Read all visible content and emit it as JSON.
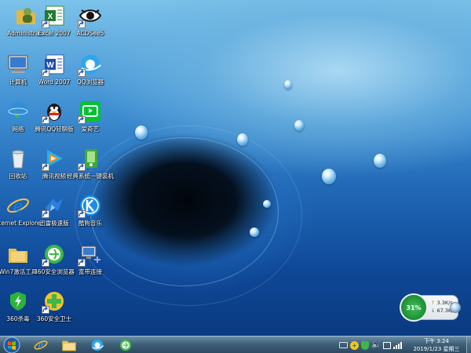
{
  "desktop_icons": [
    {
      "id": "admin-folder",
      "label": "Administra...",
      "icon": "user-folder-icon",
      "shortcut": false
    },
    {
      "id": "excel",
      "label": "Excel 2007",
      "icon": "excel-icon",
      "shortcut": true
    },
    {
      "id": "acdsee",
      "label": "ACDSee5",
      "icon": "eye-icon",
      "shortcut": true
    },
    {
      "id": "computer",
      "label": "计算机",
      "icon": "computer-icon",
      "shortcut": false
    },
    {
      "id": "word",
      "label": "Word 2007",
      "icon": "word-icon",
      "shortcut": true
    },
    {
      "id": "qq-browser",
      "label": "QQ浏览器",
      "icon": "qq-browser-icon",
      "shortcut": true
    },
    {
      "id": "network",
      "label": "网络",
      "icon": "network-globe-icon",
      "shortcut": false
    },
    {
      "id": "qq-lite",
      "label": "腾讯QQ轻聊版",
      "icon": "qq-penguin-icon",
      "shortcut": true
    },
    {
      "id": "iqiyi",
      "label": "爱奇艺",
      "icon": "iqiyi-icon",
      "shortcut": true
    },
    {
      "id": "recycle-bin",
      "label": "回收站",
      "icon": "recycle-bin-icon",
      "shortcut": false
    },
    {
      "id": "tencent-video",
      "label": "腾讯视频",
      "icon": "tencent-video-icon",
      "shortcut": true
    },
    {
      "id": "reinstall",
      "label": "经典系统一键装机",
      "icon": "reinstall-icon",
      "shortcut": true
    },
    {
      "id": "ie",
      "label": "Internet Explorer",
      "icon": "ie-icon",
      "shortcut": false
    },
    {
      "id": "xunlei",
      "label": "迅雷极速版",
      "icon": "xunlei-bird-icon",
      "shortcut": true
    },
    {
      "id": "kugou",
      "label": "酷狗音乐",
      "icon": "kugou-icon",
      "shortcut": true
    },
    {
      "id": "win7-tools",
      "label": "Win7激活工具",
      "icon": "folder-icon",
      "shortcut": false
    },
    {
      "id": "360-browser",
      "label": "360安全浏览器",
      "icon": "360-browser-icon",
      "shortcut": true
    },
    {
      "id": "broadband",
      "label": "宽带连接",
      "icon": "broadband-icon",
      "shortcut": true
    },
    {
      "id": "360-antivirus",
      "label": "360杀毒",
      "icon": "360-shield-icon",
      "shortcut": false
    },
    {
      "id": "360-guard",
      "label": "360安全卫士",
      "icon": "360-guard-icon",
      "shortcut": true
    }
  ],
  "gadget": {
    "percent": "31%",
    "upload": "3.3K/s",
    "download": "67.3K/s"
  },
  "taskbar": {
    "pinned": [
      "ie-icon",
      "explorer-folder-icon",
      "qq-browser-icon",
      "360-browser-icon"
    ],
    "tray_icons": [
      "keyboard-icon",
      "360-tray-icon",
      "shield-tray-icon",
      "volume-icon",
      "flag-icon",
      "network-tray-icon"
    ],
    "time": "下午 3:24",
    "date": "2019/1/23 星期三"
  }
}
